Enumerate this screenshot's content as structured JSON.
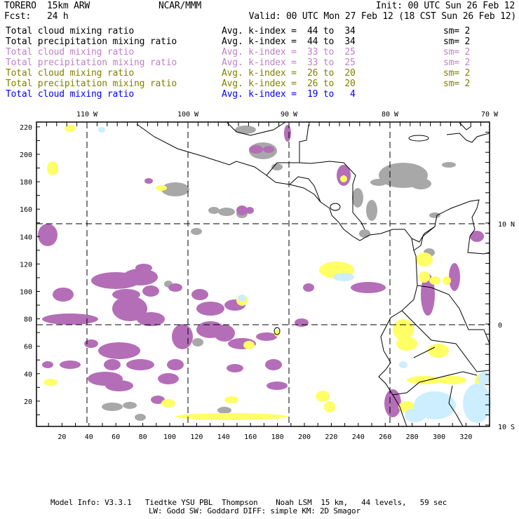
{
  "header": {
    "title": "TORERO  15km ARW",
    "org": "NCAR/MMM",
    "init": "Init: 00 UTC Sun 26 Feb 12",
    "fcst": "Fcst:   24 h",
    "valid": "Valid: 00 UTC Mon 27 Feb 12 (18 CST Sun 26 Feb 12)"
  },
  "legend": [
    {
      "field": "Total cloud mixing ratio",
      "avg": "Avg. k-index =  44 to  34",
      "sm": "sm= 2",
      "color": "#000000"
    },
    {
      "field": "Total precipitation mixing ratio",
      "avg": "Avg. k-index =  44 to  34",
      "sm": "sm= 2",
      "color": "#000000"
    },
    {
      "field": "Total cloud mixing ratio",
      "avg": "Avg. k-index =  33 to  25",
      "sm": "sm= 2",
      "color": "#c080c8"
    },
    {
      "field": "Total precipitation mixing ratio",
      "avg": "Avg. k-index =  33 to  25",
      "sm": "sm= 2",
      "color": "#c080c8"
    },
    {
      "field": "Total cloud mixing ratio",
      "avg": "Avg. k-index =  26 to  20",
      "sm": "sm= 2",
      "color": "#808000"
    },
    {
      "field": "Total precipitation mixing ratio",
      "avg": "Avg. k-index =  26 to  20",
      "sm": "sm= 2",
      "color": "#808000"
    },
    {
      "field": "Total cloud mixing ratio",
      "avg": "Avg. k-index =  19 to   4",
      "sm": "",
      "color": "#0000ff"
    }
  ],
  "map": {
    "lon_labels": [
      "110 W",
      "100 W",
      "90 W",
      "80 W",
      "70 W"
    ],
    "lat_labels": [
      "10 N",
      "0",
      "10 S"
    ],
    "x_ticks": [
      "20",
      "40",
      "60",
      "80",
      "100",
      "120",
      "140",
      "160",
      "180",
      "200",
      "220",
      "240",
      "260",
      "280",
      "300",
      "320"
    ],
    "y_ticks": [
      "20",
      "40",
      "60",
      "80",
      "100",
      "120",
      "140",
      "160",
      "180",
      "200",
      "220"
    ],
    "colors": {
      "gray": "#a8a8a8",
      "purple": "#b46eb8",
      "yellow": "#ffff66",
      "lightblue": "#cceeff"
    }
  },
  "footer": {
    "line1": "Model Info: V3.3.1   Tiedtke YSU PBL  Thompson    Noah LSM  15 km,   44 levels,   59 sec",
    "line2": "LW: Godd SW: Goddard DIFF: simple KM: 2D Smagor"
  }
}
